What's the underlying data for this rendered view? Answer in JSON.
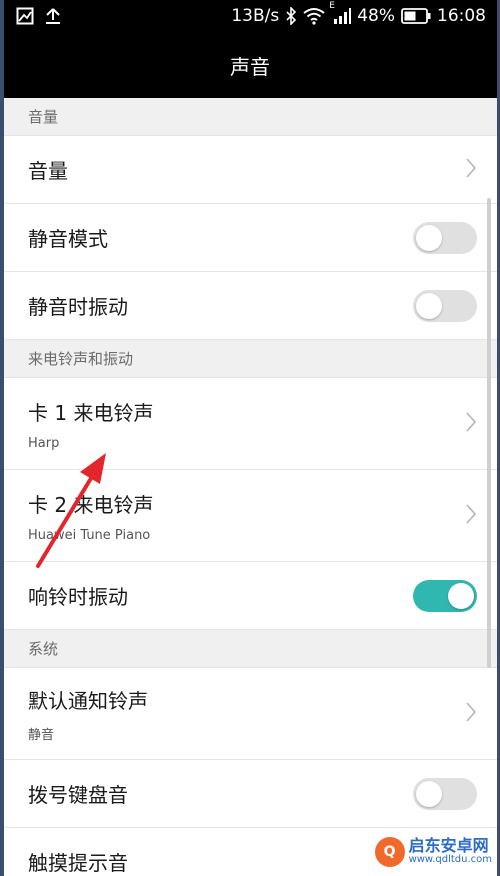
{
  "status_bar": {
    "speed": "13B/s",
    "signal_label": "E",
    "battery": "48%",
    "time": "16:08",
    "icons": [
      "image-notification-icon",
      "upload-icon",
      "bluetooth-icon",
      "wifi-icon",
      "cellular-signal-icon",
      "battery-icon"
    ]
  },
  "header": {
    "title": "声音"
  },
  "sections": {
    "volume": {
      "header": "音量",
      "volume_label": "音量",
      "silent_mode_label": "静音模式",
      "silent_vibrate_label": "静音时振动"
    },
    "ringtone": {
      "header": "来电铃声和振动",
      "card1_label": "卡 1 来电铃声",
      "card1_value": "Harp",
      "card2_label": "卡 2 来电铃声",
      "card2_value": "Huawei Tune Piano",
      "ring_vibrate_label": "响铃时振动"
    },
    "system": {
      "header": "系统",
      "notification_label": "默认通知铃声",
      "notification_value": "静音",
      "dialpad_label": "拨号键盘音",
      "touch_label": "触摸提示音"
    }
  },
  "toggles": {
    "silent_mode": false,
    "silent_vibrate": false,
    "ring_vibrate": true,
    "dialpad": false
  },
  "colors": {
    "accent": "#30b8b0",
    "annotation_arrow": "#e3262b"
  },
  "watermark": {
    "name": "启东安卓网",
    "url": "www.qdltdu.com"
  }
}
